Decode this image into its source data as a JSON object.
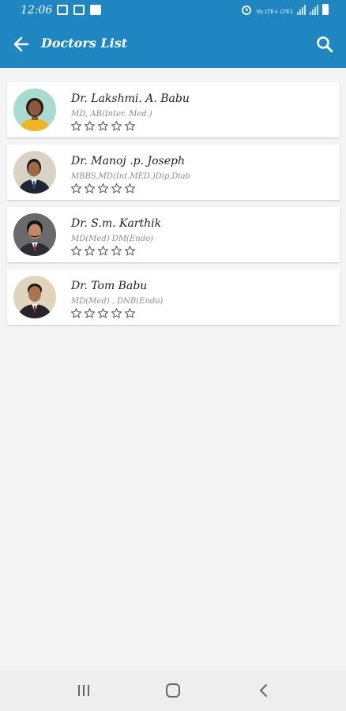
{
  "status_bar": {
    "time": "12:06",
    "network": "Vo LTE+ LTE1"
  },
  "app_bar": {
    "title": "Doctors List"
  },
  "doctors": [
    {
      "name": "Dr. Lakshmi. A. Babu",
      "qualifications": "MD, AB(Inter. Med.)",
      "rating": 0,
      "max_rating": 5
    },
    {
      "name": "Dr. Manoj .p. Joseph",
      "qualifications": "MBBS,MD(Int.MED.)Dip,Diab",
      "rating": 0,
      "max_rating": 5
    },
    {
      "name": "Dr. S.m. Karthik",
      "qualifications": "MD(Med) DM(Endo)",
      "rating": 0,
      "max_rating": 5
    },
    {
      "name": "Dr. Tom Babu",
      "qualifications": "MD(Med) , DNB(Endo)",
      "rating": 0,
      "max_rating": 5
    }
  ],
  "colors": {
    "primary": "#1f86c2",
    "background": "#f4f4f4",
    "card": "#ffffff"
  },
  "icons": {
    "back": "arrow-left-icon",
    "search": "search-icon",
    "star": "star-outline-icon",
    "nav_recents": "recents-icon",
    "nav_home": "home-icon",
    "nav_back": "back-chevron-icon"
  }
}
